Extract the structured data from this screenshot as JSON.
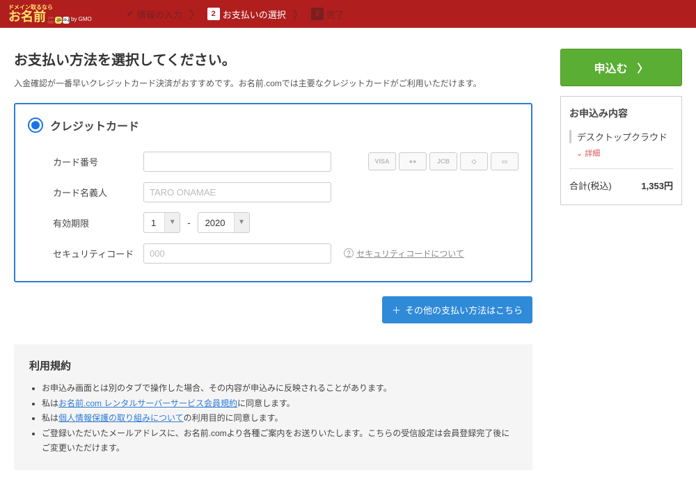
{
  "logo": {
    "tagline": "ドメイン取るなら",
    "brand": "お名前",
    "dot1": ".com",
    "dot2": ".jp",
    "dot3": ".co.jp",
    "sub": "by GMO"
  },
  "steps": {
    "s1": "情報の入力",
    "s2": "お支払いの選択",
    "s3": "完了"
  },
  "page": {
    "title": "お支払い方法を選択してください。",
    "subtitle": "入金確認が一番早いクレジットカード決済がおすすめです。お名前.comでは主要なクレジットカードがご利用いただけます。"
  },
  "method": {
    "name": "クレジットカード"
  },
  "form": {
    "card_number_label": "カード番号",
    "card_name_label": "カード名義人",
    "card_name_placeholder": "TARO ONAMAE",
    "expiry_label": "有効期限",
    "expiry_month": "1",
    "expiry_year": "2020",
    "expiry_sep": "-",
    "cvc_label": "セキュリティコード",
    "cvc_placeholder": "000",
    "cvc_help": "セキュリティコードについて"
  },
  "card_brands": [
    "VISA",
    "●●",
    "JCB",
    "◇",
    "▭"
  ],
  "other_pay": "その他の支払い方法はこちら",
  "terms": {
    "title": "利用規約",
    "items": [
      "お申込み画面とは別のタブで操作した場合、その内容が申込みに反映されることがあります。",
      "私は<a>お名前.com レンタルサーバーサービス会員規約</a>に同意します。",
      "私は<a>個人情報保護の取り組みについて</a>の利用目的に同意します。",
      "ご登録いただいたメールアドレスに、お名前.comより各種ご案内をお送りいたします。こちらの受信設定は会員登録完了後にご変更いただけます。"
    ]
  },
  "side": {
    "apply": "申込む",
    "summary_title": "お申込み内容",
    "item": "デスクトップクラウド",
    "detail": "詳細",
    "total_label": "合計(税込)",
    "total_value": "1,353円"
  }
}
